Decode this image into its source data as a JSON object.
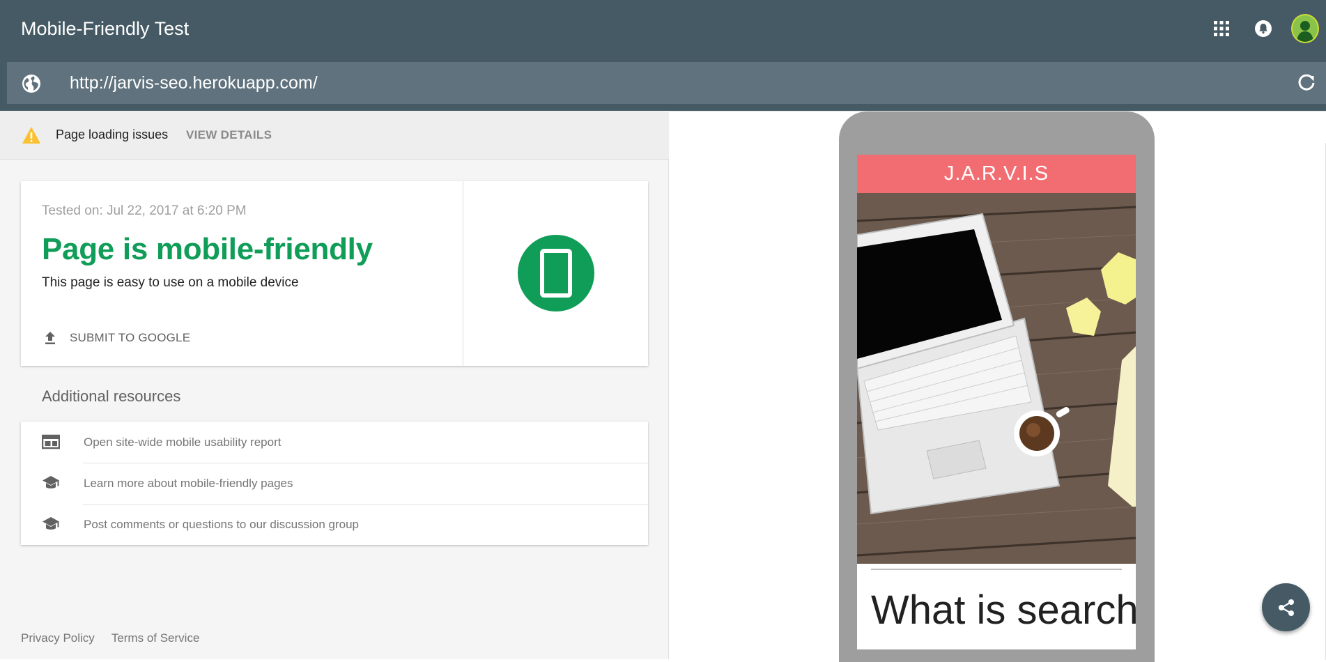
{
  "header": {
    "title": "Mobile-Friendly Test",
    "apps_icon": "apps-grid-icon",
    "notifications_icon": "bell-icon",
    "avatar_icon": "user-avatar"
  },
  "url_bar": {
    "globe_icon": "globe-icon",
    "url": "http://jarvis-seo.herokuapp.com/",
    "reload_icon": "refresh-icon"
  },
  "warning": {
    "icon": "warning-triangle-icon",
    "text": "Page loading issues",
    "link_label": "VIEW DETAILS"
  },
  "result": {
    "tested_on": "Tested on: Jul 22, 2017 at 6:20 PM",
    "headline": "Page is mobile-friendly",
    "description": "This page is easy to use on a mobile device",
    "submit_label": "SUBMIT TO GOOGLE",
    "submit_icon": "upload-icon",
    "badge_icon": "smartphone-icon",
    "accent_color": "#0f9d58"
  },
  "resources": {
    "title": "Additional resources",
    "items": [
      {
        "label": "Open site-wide mobile usability report",
        "icon": "web-report-icon"
      },
      {
        "label": "Learn more about mobile-friendly pages",
        "icon": "school-icon"
      },
      {
        "label": "Post comments or questions to our discussion group",
        "icon": "school-icon"
      }
    ]
  },
  "footer": {
    "privacy": "Privacy Policy",
    "terms": "Terms of Service"
  },
  "preview": {
    "site_title": "J.A.R.V.I.S",
    "article_title": "What is search engine",
    "header_color": "#f26d72",
    "hero_description_icon": "laptop-on-wooden-desk-image"
  },
  "share_fab": {
    "icon": "share-icon"
  },
  "colors": {
    "topbar": "#455a64",
    "urlbar": "#5f727d",
    "warning": "#fbc02d"
  }
}
